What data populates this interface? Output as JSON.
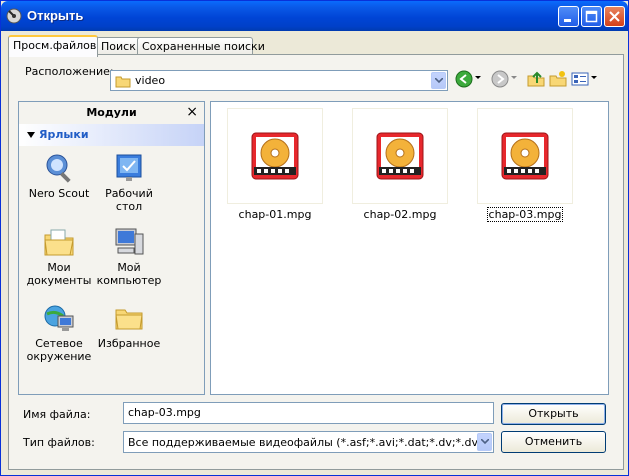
{
  "window": {
    "title": "Открыть"
  },
  "tabs": [
    {
      "label": "Просм.файлов",
      "active": true
    },
    {
      "label": "Поиск",
      "active": false
    },
    {
      "label": "Сохраненные поиски",
      "active": false
    }
  ],
  "location": {
    "label": "Расположение:",
    "value": "video"
  },
  "modules": {
    "title": "Модули",
    "close": "×",
    "section": "Ярлыки",
    "items": [
      {
        "label": "Nero Scout",
        "icon": "nero-scout-icon"
      },
      {
        "label": "Рабочий стол",
        "icon": "desktop-icon"
      },
      {
        "label": "Мои документы",
        "icon": "my-documents-icon"
      },
      {
        "label": "Мой компьютер",
        "icon": "my-computer-icon"
      },
      {
        "label": "Сетевое окружение",
        "icon": "network-icon"
      },
      {
        "label": "Избранное",
        "icon": "favorites-folder-icon"
      }
    ]
  },
  "files": [
    {
      "name": "chap-01.mpg",
      "selected": false
    },
    {
      "name": "chap-02.mpg",
      "selected": false
    },
    {
      "name": "chap-03.mpg",
      "selected": true
    }
  ],
  "filename": {
    "label": "Имя файла:",
    "value": "chap-03.mpg"
  },
  "filetype": {
    "label": "Тип файлов:",
    "value": "Все поддерживаемые видеофайлы (*.asf;*.avi;*.dat;*.dv;*.dvr-ms;*"
  },
  "buttons": {
    "open": "Открыть",
    "cancel": "Отменить"
  },
  "colors": {
    "titlebar": "#0054e3",
    "accent": "#215dc6",
    "tab_highlight": "#ffc83c"
  }
}
